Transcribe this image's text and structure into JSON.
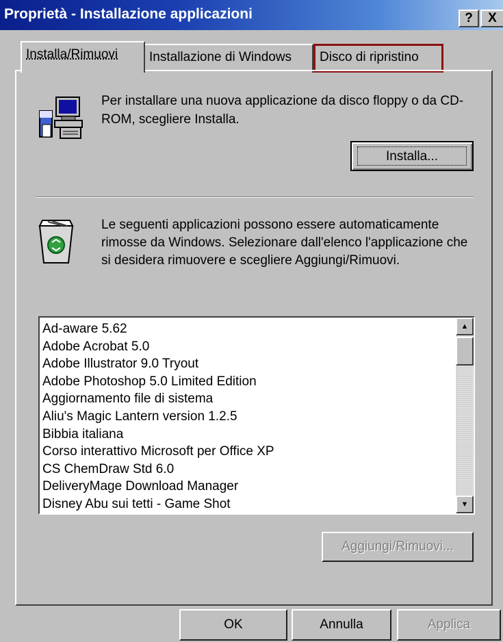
{
  "window": {
    "title": "Proprietà - Installazione applicazioni"
  },
  "titlebar": {
    "help_label": "?",
    "close_label": "X"
  },
  "tabs": [
    {
      "label": "Installa/Rimuovi"
    },
    {
      "label": "Installazione di Windows"
    },
    {
      "label": "Disco di ripristino"
    }
  ],
  "install": {
    "text": "Per installare una nuova applicazione da disco floppy o da CD-ROM, scegliere Installa.",
    "button_label": "Installa..."
  },
  "remove": {
    "text": "Le seguenti applicazioni possono essere automaticamente rimosse da Windows. Selezionare dall'elenco l'applicazione che si desidera rimuovere e scegliere Aggiungi/Rimuovi.",
    "items": [
      "Ad-aware 5.62",
      "Adobe Acrobat 5.0",
      "Adobe Illustrator 9.0 Tryout",
      "Adobe Photoshop 5.0 Limited Edition",
      "Aggiornamento file di sistema",
      "Aliu's Magic Lantern version 1.2.5",
      "Bibbia italiana",
      "Corso interattivo Microsoft per Office XP",
      "CS ChemDraw Std 6.0",
      "DeliveryMage Download Manager",
      "Disney Abu sui tetti - Game Shot"
    ],
    "button_label": "Aggiungi/Rimuovi..."
  },
  "footer": {
    "ok_label": "OK",
    "cancel_label": "Annulla",
    "apply_label": "Applica"
  },
  "colors": {
    "face": "#c0c0c0",
    "title_start": "#0a1f8c",
    "title_end": "#a7c8ee",
    "highlight_border": "#8b1111"
  }
}
